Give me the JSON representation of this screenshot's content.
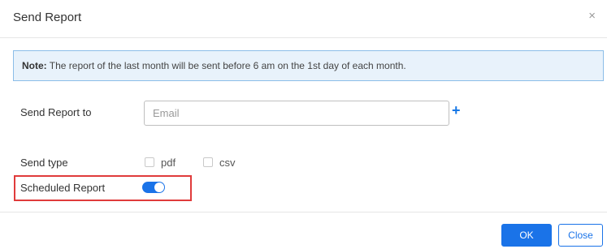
{
  "dialog": {
    "title": "Send Report",
    "close_icon": "×"
  },
  "note": {
    "label": "Note:",
    "text": " The report of the last month will be sent before 6 am on the 1st day of each month."
  },
  "send_to": {
    "label": "Send Report to",
    "email_value": "",
    "email_placeholder": "Email",
    "add_icon": "+"
  },
  "send_type": {
    "label": "Send type",
    "options": [
      {
        "label": "pdf",
        "checked": false
      },
      {
        "label": "csv",
        "checked": false
      }
    ]
  },
  "scheduled": {
    "label": "Scheduled Report",
    "enabled": true
  },
  "footer": {
    "ok_label": "OK",
    "close_label": "Close"
  },
  "colors": {
    "accent": "#1a73e8",
    "highlight_border": "#e03b3b",
    "note_bg": "#e8f2fb",
    "note_border": "#8bbde8"
  }
}
